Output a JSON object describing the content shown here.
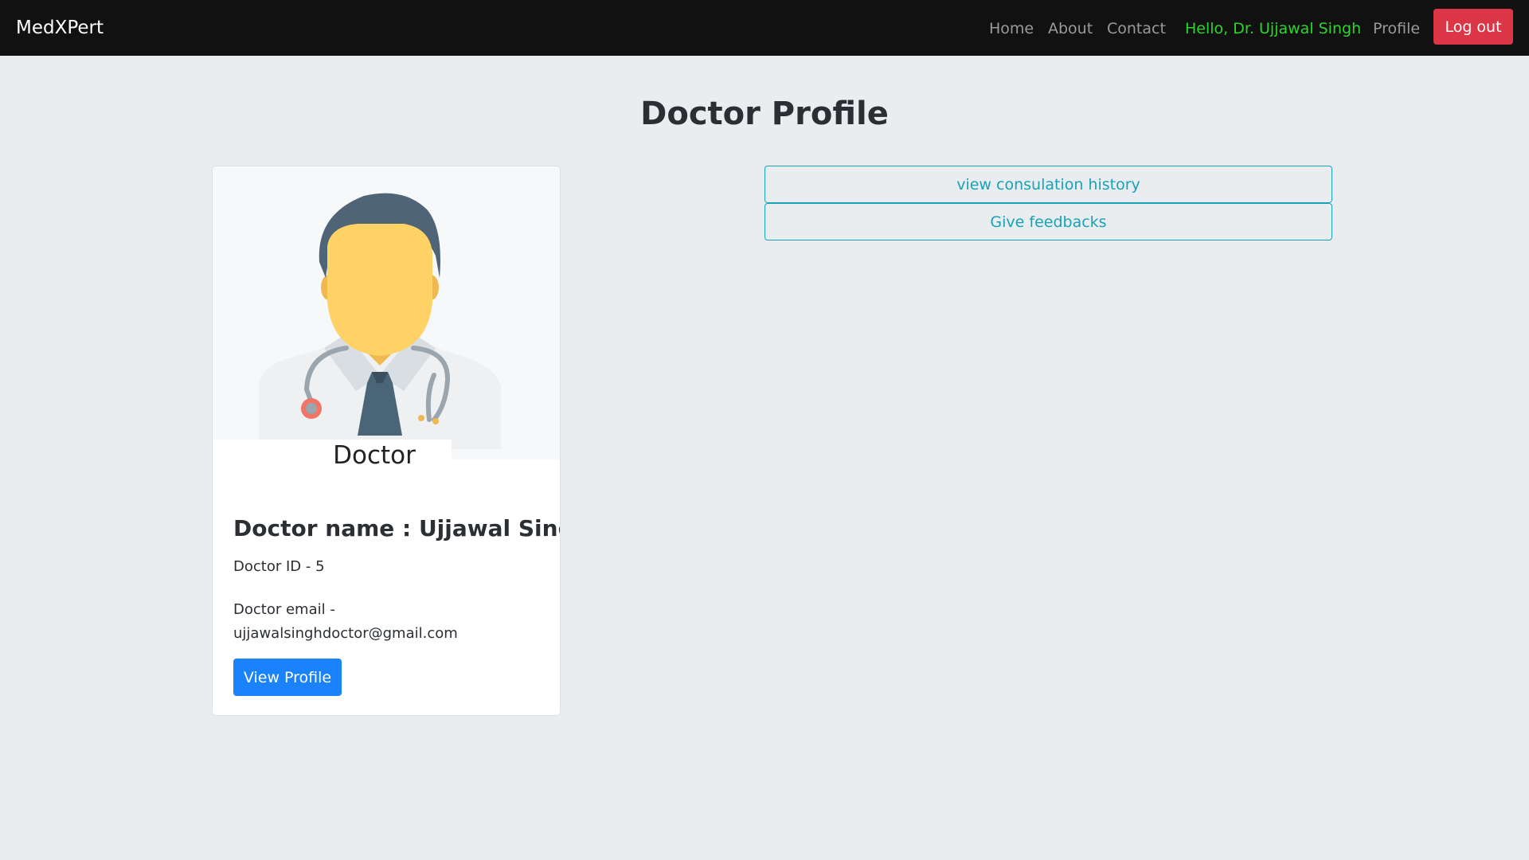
{
  "navbar": {
    "brand": "MedXPert",
    "links": [
      {
        "label": "Home"
      },
      {
        "label": "About"
      },
      {
        "label": "Contact"
      }
    ],
    "greeting": "Hello, Dr. Ujjawal Singh",
    "profile_label": "Profile",
    "logout_label": "Log out"
  },
  "page": {
    "title": "Doctor Profile"
  },
  "card": {
    "image_caption": "Doctor",
    "name": "Doctor name : Ujjawal Singh",
    "doctor_id": "Doctor ID - 5",
    "email_label": "Doctor email -",
    "email": "ujjawalsinghdoctor@gmail.com",
    "view_profile_label": "View Profile"
  },
  "actions": {
    "history_label": "view consulation history",
    "feedback_label": "Give feedbacks"
  },
  "colors": {
    "navbar_bg": "#111111",
    "greeting": "#2cd52c",
    "logout": "#dc3545",
    "primary": "#1a82fb",
    "outline_info": "#17a2b8",
    "page_bg": "#e9edf0"
  }
}
